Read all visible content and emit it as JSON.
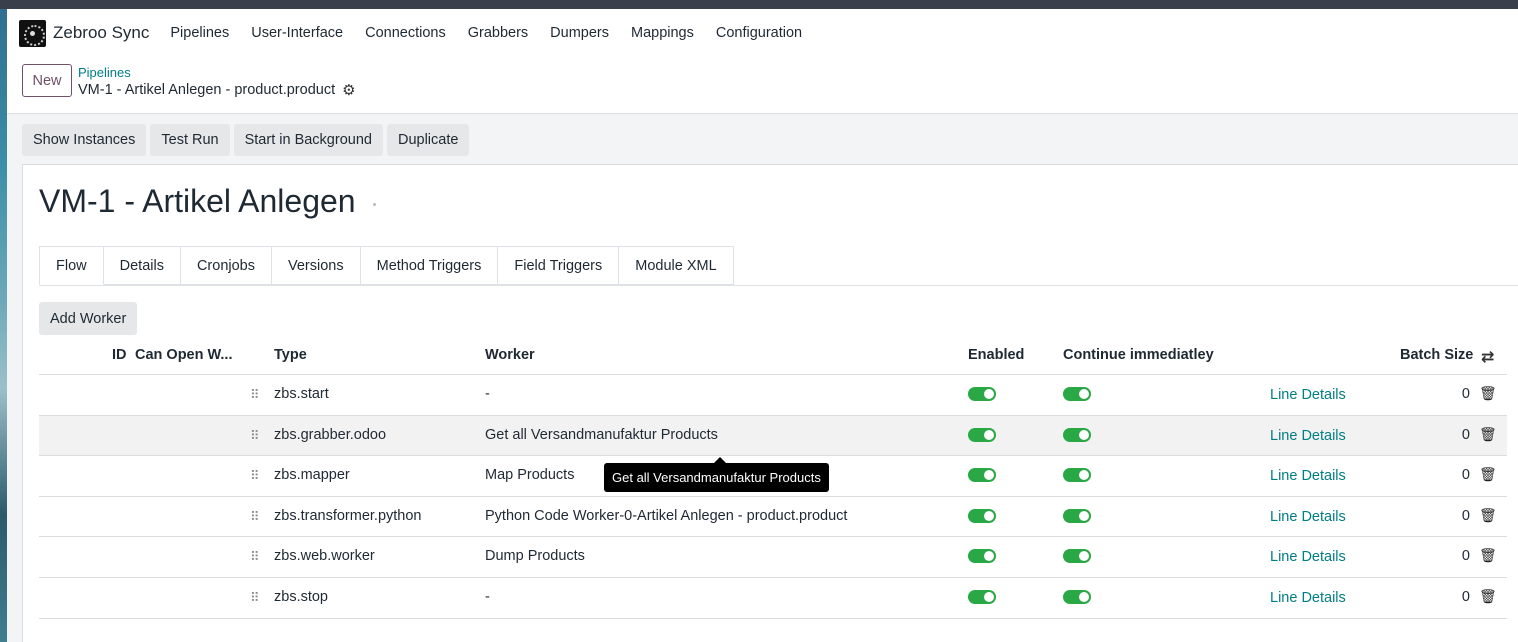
{
  "app": {
    "brand": "Zebroo Sync"
  },
  "nav": [
    "Pipelines",
    "User-Interface",
    "Connections",
    "Grabbers",
    "Dumpers",
    "Mappings",
    "Configuration"
  ],
  "control": {
    "new_label": "New",
    "breadcrumb_parent": "Pipelines",
    "breadcrumb_current": "VM-1 - Artikel Anlegen - product.product"
  },
  "actions": [
    "Show Instances",
    "Test Run",
    "Start in Background",
    "Duplicate"
  ],
  "record": {
    "title": "VM-1 - Artikel Anlegen"
  },
  "tabs": [
    "Flow",
    "Details",
    "Cronjobs",
    "Versions",
    "Method Triggers",
    "Field Triggers",
    "Module XML"
  ],
  "flow": {
    "add_worker_label": "Add Worker",
    "columns": {
      "id": "ID",
      "can_open": "Can Open W...",
      "type": "Type",
      "worker": "Worker",
      "enabled": "Enabled",
      "continue": "Continue immediatley",
      "batch_size": "Batch Size"
    },
    "rows": [
      {
        "type": "zbs.start",
        "worker": "-",
        "enabled": true,
        "continue": true,
        "link": "Line Details",
        "batch": "0"
      },
      {
        "type": "zbs.grabber.odoo",
        "worker": "Get all Versandmanufaktur Products",
        "enabled": true,
        "continue": true,
        "link": "Line Details",
        "batch": "0"
      },
      {
        "type": "zbs.mapper",
        "worker": "Map Products",
        "enabled": true,
        "continue": true,
        "link": "Line Details",
        "batch": "0"
      },
      {
        "type": "zbs.transformer.python",
        "worker": "Python Code Worker-0-Artikel Anlegen - product.product",
        "enabled": true,
        "continue": true,
        "link": "Line Details",
        "batch": "0"
      },
      {
        "type": "zbs.web.worker",
        "worker": "Dump Products",
        "enabled": true,
        "continue": true,
        "link": "Line Details",
        "batch": "0"
      },
      {
        "type": "zbs.stop",
        "worker": "-",
        "enabled": true,
        "continue": true,
        "link": "Line Details",
        "batch": "0"
      }
    ]
  },
  "tooltip": {
    "text": "Get all Versandmanufaktur Products"
  },
  "colors": {
    "link": "#017e84",
    "toggle_on": "#2aa845",
    "brand_accent": "#71506a"
  }
}
